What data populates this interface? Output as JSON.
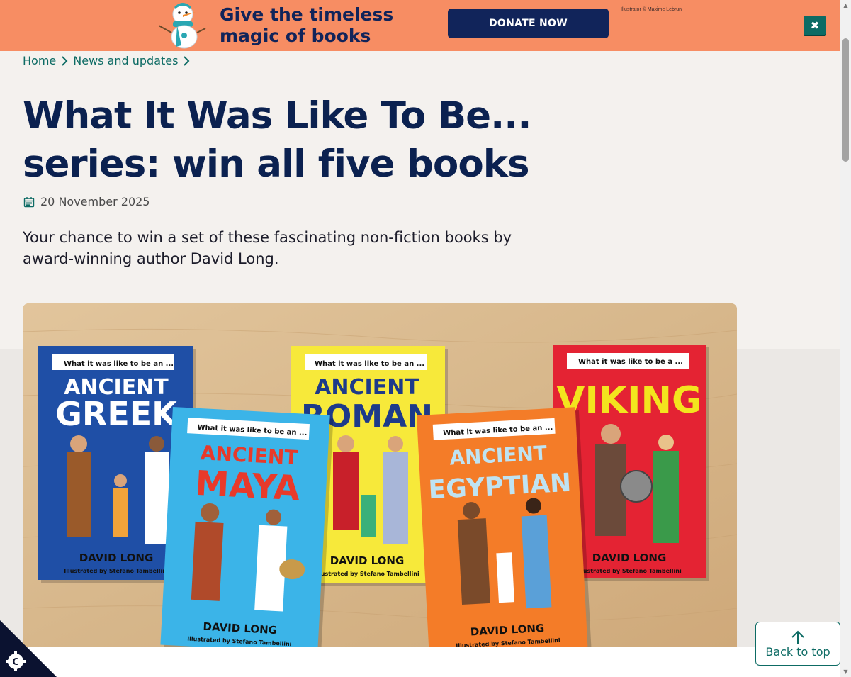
{
  "banner": {
    "headline": "Give the timeless magic of books",
    "donate_label": "DONATE NOW",
    "credit": "Illustrator © Maxime Lebrun",
    "close_glyph": "✖",
    "background": "#f78d63",
    "button_color": "#11245a"
  },
  "breadcrumb": {
    "items": [
      {
        "label": "Home"
      },
      {
        "label": "News and updates"
      }
    ],
    "separator_icon": "chevron-right-icon"
  },
  "article": {
    "title": "What It Was Like To Be... series: win all five books",
    "date": "20 November 2025",
    "date_icon": "calendar-icon",
    "intro": "Your chance to win a set of these fascinating non-fiction books by award-winning author David Long."
  },
  "hero": {
    "books": [
      {
        "label": "What it was like to be an ...",
        "title_lines": [
          "ANCIENT",
          "GREEK"
        ],
        "author": "DAVID LONG",
        "illustrator": "Illustrated by Stefano Tambellini",
        "color": "#1f4fa6"
      },
      {
        "label": "What it was like to be an ...",
        "title_lines": [
          "ANCIENT",
          "ROMAN"
        ],
        "author": "DAVID LONG",
        "illustrator": "Illustrated by Stefano Tambellini",
        "color": "#f7e93a"
      },
      {
        "label": "What it was like to be a ...",
        "title_lines": [
          "VIKING"
        ],
        "author": "DAVID LONG",
        "illustrator": "Illustrated by Stefano Tambellini",
        "color": "#e42333"
      },
      {
        "label": "What it was like to be an ...",
        "title_lines": [
          "ANCIENT",
          "MAYA"
        ],
        "author": "DAVID LONG",
        "illustrator": "Illustrated by Stefano Tambellini",
        "color": "#3bb4e8"
      },
      {
        "label": "What it was like to be an ...",
        "title_lines": [
          "ANCIENT",
          "EGYPTIAN"
        ],
        "author": "DAVID LONG",
        "illustrator": "Illustrated by Stefano Tambellini",
        "color": "#f47c28"
      }
    ]
  },
  "back_to_top": {
    "label": "Back to top",
    "icon": "arrow-up-icon"
  },
  "cookie": {
    "icon": "cookie-settings-icon",
    "glyph": "C"
  },
  "colors": {
    "accent_teal": "#0d6b64",
    "navy": "#0b2150",
    "page_bg": "#f4f1ee"
  }
}
